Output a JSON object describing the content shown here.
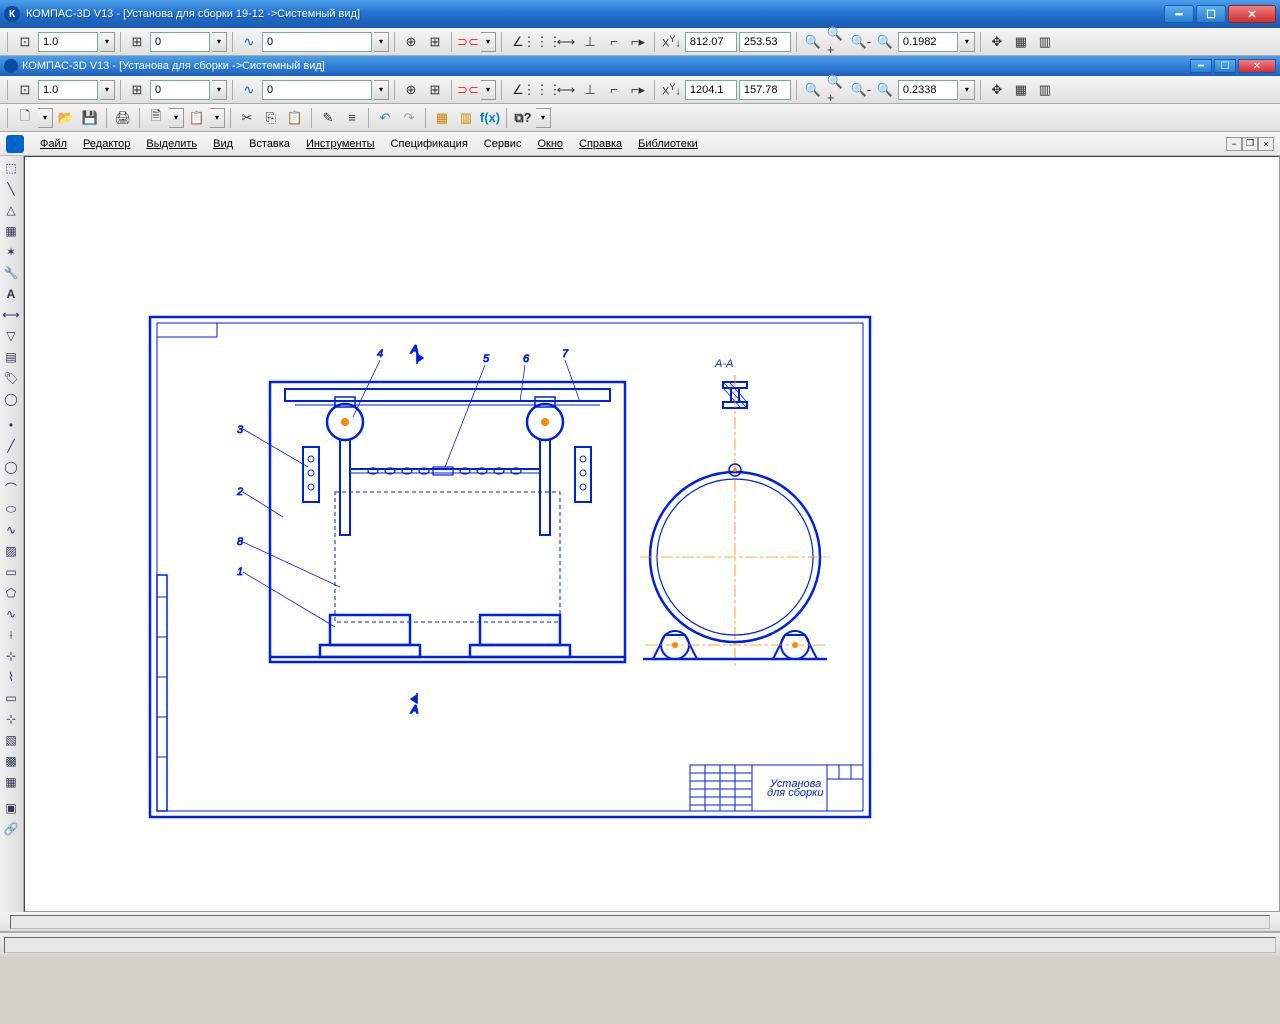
{
  "app_title": "КОМПАС-3D V13 - [Установа для  сборки 19-12 ->Системный вид]",
  "doc_title": "КОМПАС-3D V13 - [Установа для сборки ->Системный вид]",
  "toolbar1": {
    "scale": "1.0",
    "step": "0",
    "style": "0",
    "x_coord": "812.07",
    "y_coord": "253.53",
    "zoom": "0.1982"
  },
  "toolbar2": {
    "scale": "1.0",
    "step": "0",
    "style": "0",
    "x_coord": "1204.1",
    "y_coord": "157.78",
    "zoom": "0.2338"
  },
  "menu": {
    "file": "Файл",
    "edit": "Редактор",
    "select": "Выделить",
    "view": "Вид",
    "insert": "Вставка",
    "tools": "Инструменты",
    "spec": "Спецификация",
    "service": "Сервис",
    "window": "Окно",
    "help": "Справка",
    "libs": "Библиотеки"
  },
  "drawing": {
    "section_label": "А-А",
    "title_block": "Установа для сборки"
  },
  "coord_labels": {
    "x": "X",
    "y": "Y"
  }
}
